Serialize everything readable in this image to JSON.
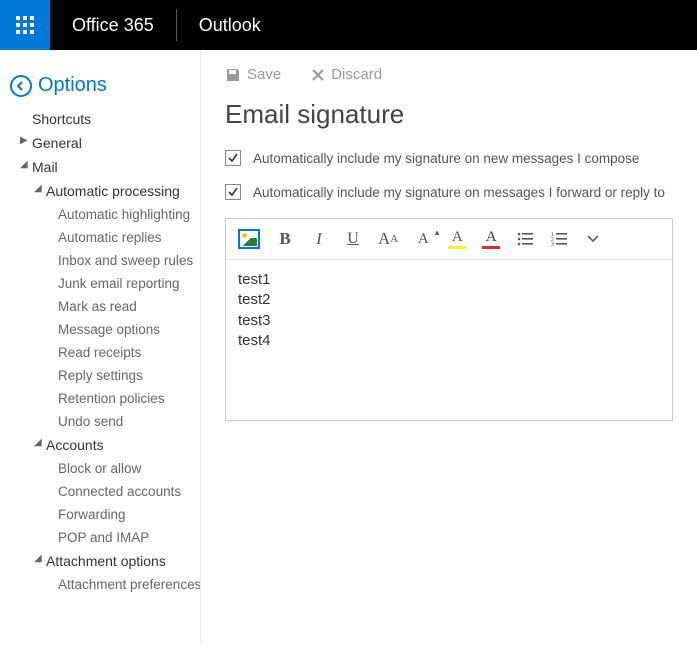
{
  "header": {
    "suite": "Office 365",
    "app": "Outlook"
  },
  "options_label": "Options",
  "sidebar": {
    "shortcuts": "Shortcuts",
    "general": "General",
    "mail": "Mail",
    "auto_processing": "Automatic processing",
    "auto_items": [
      "Automatic highlighting",
      "Automatic replies",
      "Inbox and sweep rules",
      "Junk email reporting",
      "Mark as read",
      "Message options",
      "Read receipts",
      "Reply settings",
      "Retention policies",
      "Undo send"
    ],
    "accounts": "Accounts",
    "accounts_items": [
      "Block or allow",
      "Connected accounts",
      "Forwarding",
      "POP and IMAP"
    ],
    "attachment_options": "Attachment options",
    "attachment_items": [
      "Attachment preferences"
    ]
  },
  "toolbar": {
    "save": "Save",
    "discard": "Discard"
  },
  "page_title": "Email signature",
  "checks": {
    "c1": "Automatically include my signature on new messages I compose",
    "c2": "Automatically include my signature on messages I forward or reply to"
  },
  "signature_lines": [
    "test1",
    "test2",
    "test3",
    "test4"
  ]
}
